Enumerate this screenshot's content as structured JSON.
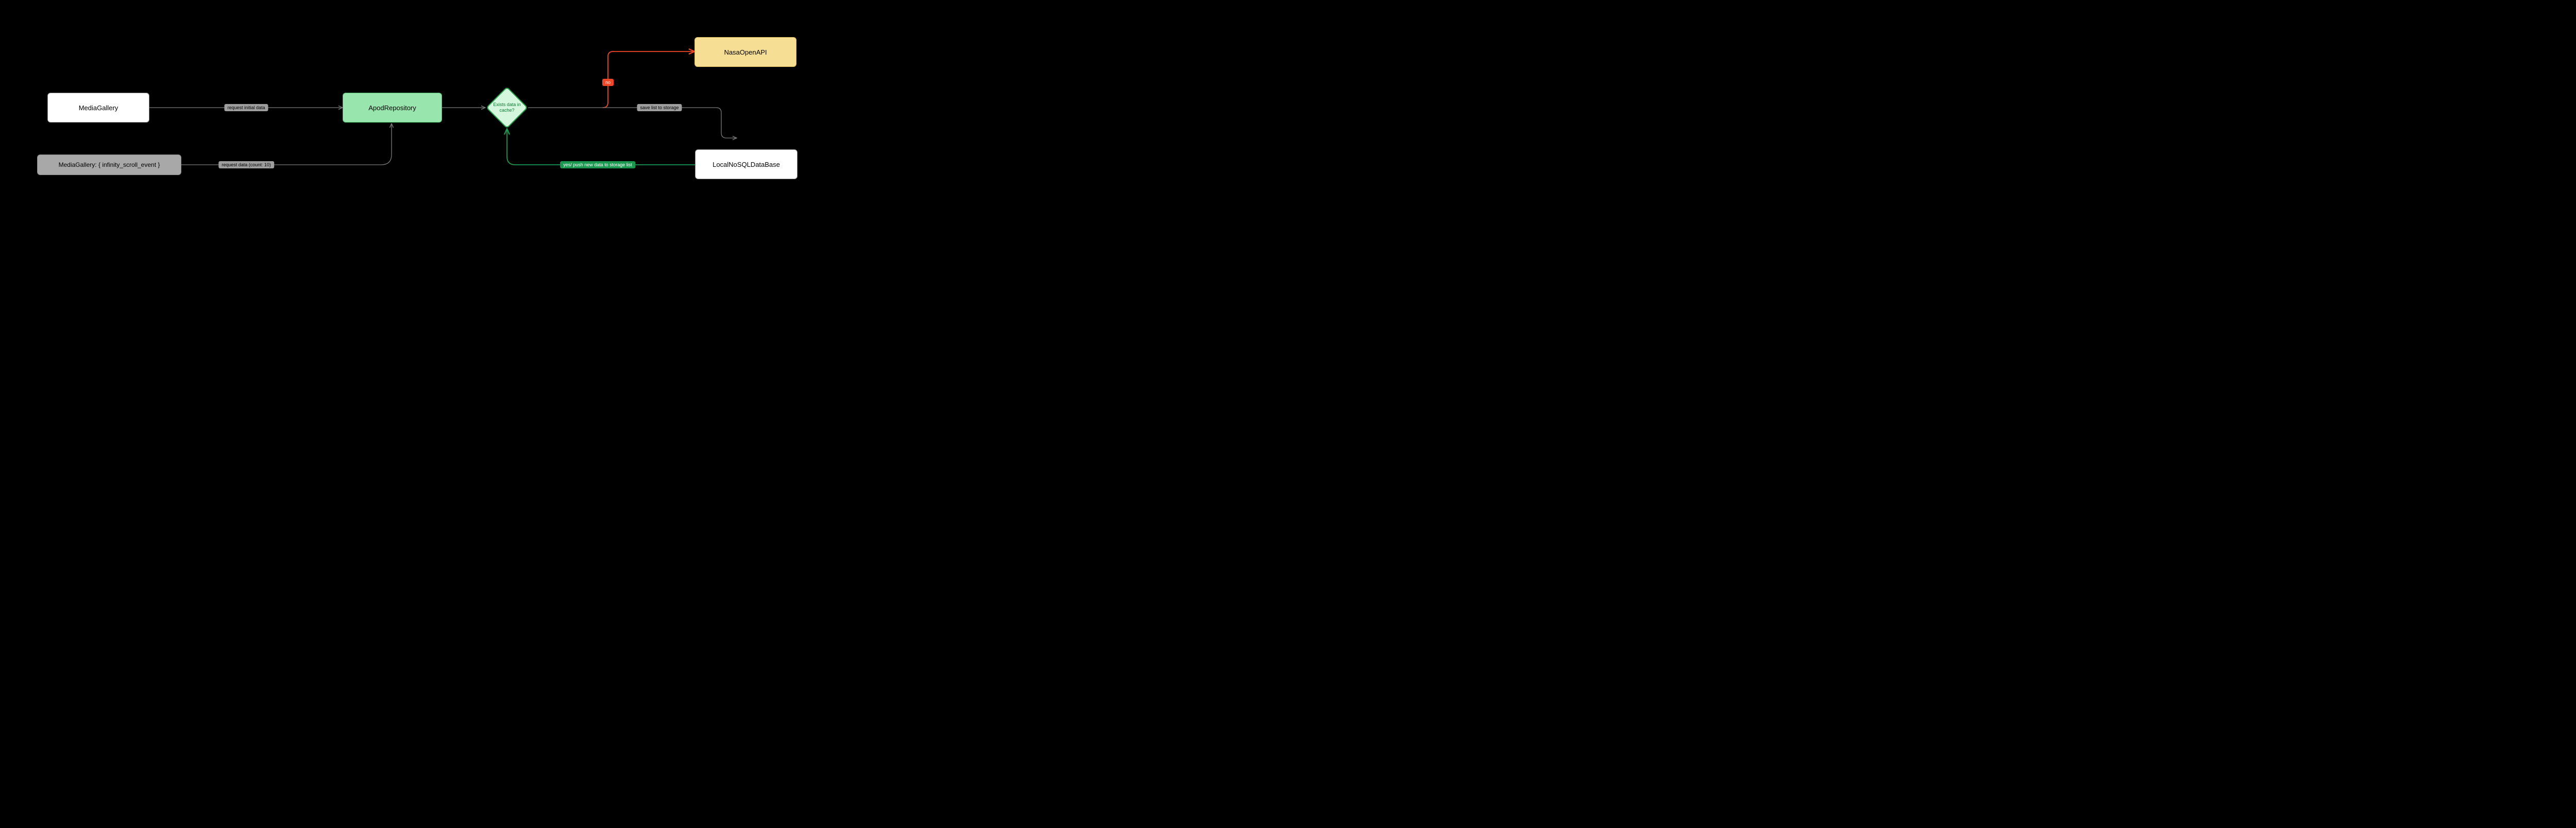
{
  "nodes": {
    "media_gallery": "MediaGallery",
    "apod_repo": "ApodRepository",
    "nasa_api": "NasaOpenAPI",
    "localdb": "LocalNoSQLDataBase",
    "infinity_event": "MediaGallery: { infinity_scroll_event }",
    "decision": "Exists data in cache?"
  },
  "edges": {
    "request_initial": "request initial data",
    "request_count": "request data (count: 10)",
    "save_list": "save list to storage",
    "no": "no",
    "yes_push": "yes/ push new data to storage list"
  }
}
